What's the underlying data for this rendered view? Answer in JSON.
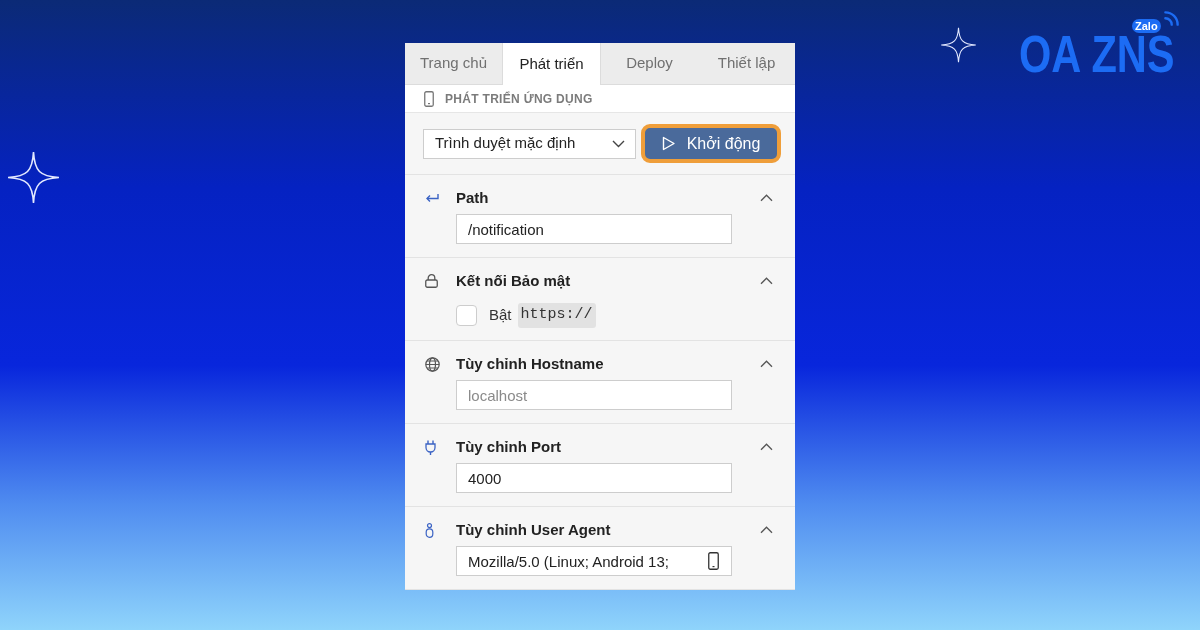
{
  "tabs": [
    {
      "label": "Trang chủ",
      "selected": false
    },
    {
      "label": "Phát triển",
      "selected": true
    },
    {
      "label": "Deploy",
      "selected": false
    },
    {
      "label": "Thiết lập",
      "selected": false
    }
  ],
  "panel_heading": {
    "title": "PHÁT TRIỂN ỨNG DỤNG"
  },
  "launcher": {
    "browser_select": {
      "value": "Trình duyệt mặc định"
    },
    "start_button": {
      "label": "Khởi động",
      "focused": true
    }
  },
  "settings": {
    "path": {
      "title": "Path",
      "expanded": true,
      "input": {
        "value": "/notification"
      }
    },
    "secure_connection": {
      "title": "Kết nối Bảo mật",
      "expanded": true,
      "checkbox": {
        "label": "Bật",
        "code": "https://",
        "checked": false
      }
    },
    "hostname": {
      "title": "Tùy chỉnh Hostname",
      "expanded": true,
      "input": {
        "placeholder": "localhost"
      }
    },
    "port": {
      "title": "Tùy chỉnh Port",
      "expanded": true,
      "input": {
        "value": "4000"
      }
    },
    "user_agent": {
      "title": "Tùy chỉnh User Agent",
      "expanded": true,
      "input": {
        "value": "Mozilla/5.0 (Linux; Android 13;"
      }
    }
  },
  "brand": {
    "wordmark": "OA ZNS",
    "badge": "Zalo"
  }
}
